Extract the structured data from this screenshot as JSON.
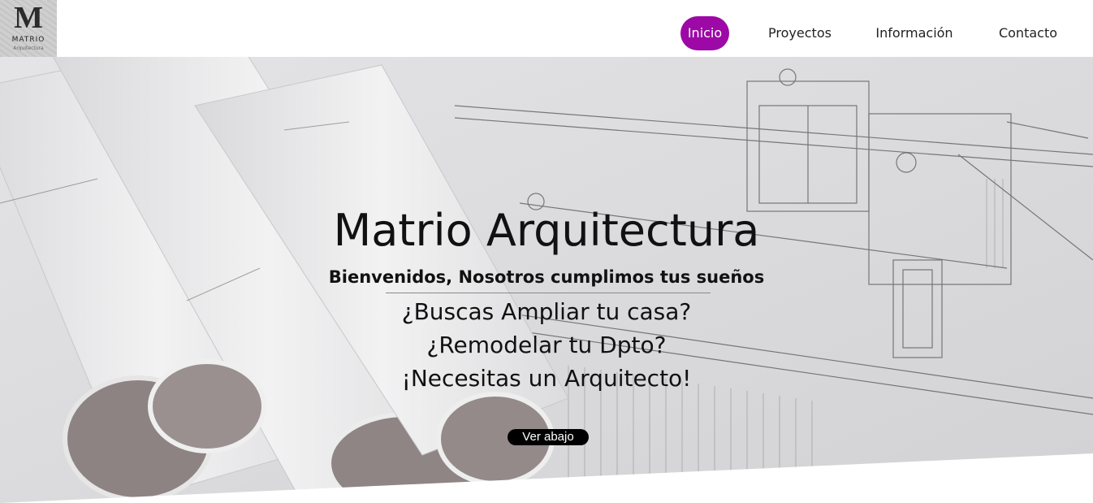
{
  "brand": {
    "letter": "M",
    "name": "MATRIO",
    "sub": "Arquitectura"
  },
  "nav": {
    "items": [
      "Inicio",
      "Proyectos",
      "Información",
      "Contacto"
    ],
    "active_index": 0,
    "active_color": "#9c09a6"
  },
  "hero": {
    "title": "Matrio Arquitectura",
    "subtitle": "Bienvenidos, Nosotros cumplimos tus sueños",
    "lines": [
      "¿Buscas Ampliar tu casa?",
      "¿Remodelar tu Dpto?",
      "¡Necesitas un Arquitecto!"
    ],
    "button": "Ver abajo"
  }
}
